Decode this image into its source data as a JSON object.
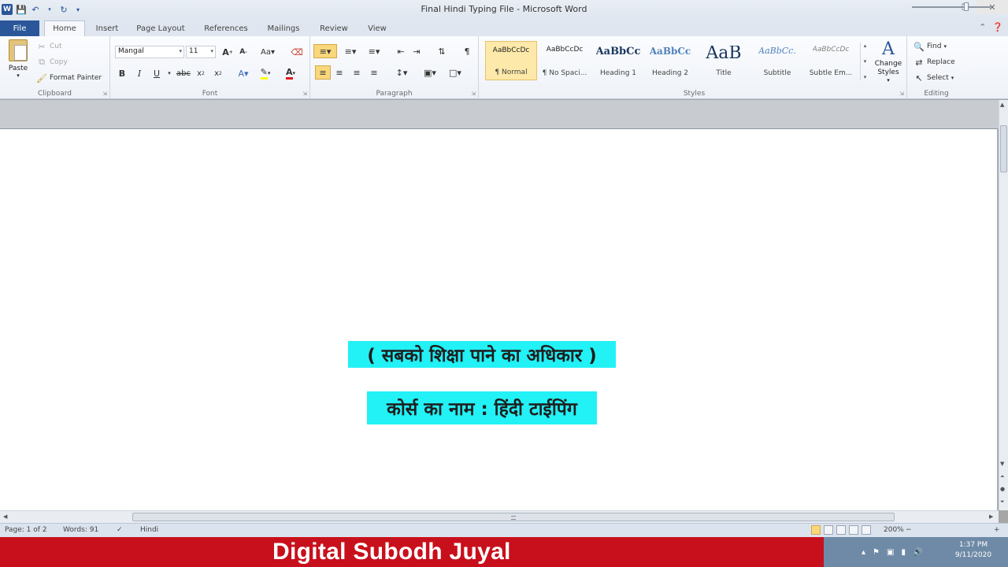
{
  "window": {
    "title": "Final Hindi Typing File - Microsoft Word"
  },
  "tabs": [
    {
      "label": "File"
    },
    {
      "label": "Home"
    },
    {
      "label": "Insert"
    },
    {
      "label": "Page Layout"
    },
    {
      "label": "References"
    },
    {
      "label": "Mailings"
    },
    {
      "label": "Review"
    },
    {
      "label": "View"
    }
  ],
  "clipboard": {
    "paste_label": "Paste",
    "cut_label": "Cut",
    "copy_label": "Copy",
    "format_painter_label": "Format Painter",
    "group_label": "Clipboard"
  },
  "font": {
    "font_name": "Mangal",
    "font_size": "11",
    "group_label": "Font",
    "change_case_label": "Aa"
  },
  "paragraph": {
    "group_label": "Paragraph"
  },
  "styles": {
    "group_label": "Styles",
    "items": [
      {
        "preview": "AaBbCcDc",
        "name": "¶ Normal"
      },
      {
        "preview": "AaBbCcDc",
        "name": "¶ No Spaci..."
      },
      {
        "preview": "AaBbCc",
        "name": "Heading 1"
      },
      {
        "preview": "AaBbCc",
        "name": "Heading 2"
      },
      {
        "preview": "AaB",
        "name": "Title"
      },
      {
        "preview": "AaBbCc.",
        "name": "Subtitle"
      },
      {
        "preview": "AaBbCcDc",
        "name": "Subtle Em..."
      }
    ],
    "change_styles_label": "Change Styles"
  },
  "editing": {
    "group_label": "Editing",
    "find_label": "Find",
    "replace_label": "Replace",
    "select_label": "Select"
  },
  "document": {
    "line1": "( सबको शिक्षा पाने का अधिकार )",
    "line2": "कोर्स का नाम : हिंदी टाईपिंग",
    "highlight_color": "#22f1f6"
  },
  "status": {
    "page": "Page: 1 of 2",
    "words": "Words: 91",
    "language": "Hindi",
    "zoom": "200%"
  },
  "banner": {
    "text": "Digital Subodh Juyal",
    "color": "#c8101c"
  },
  "clock": {
    "time": "1:37 PM",
    "date": "9/11/2020"
  }
}
